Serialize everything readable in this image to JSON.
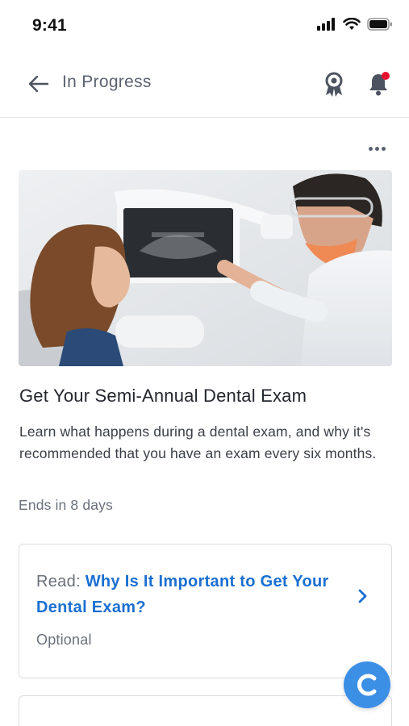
{
  "status_bar": {
    "time": "9:41",
    "icons": [
      "signal-icon",
      "wifi-icon",
      "battery-icon"
    ]
  },
  "header": {
    "back_icon": "arrow-left-icon",
    "title": "In Progress",
    "award_icon": "award-ribbon-icon",
    "bell_icon": "bell-icon",
    "notification_dot_color": "#e5142e"
  },
  "more_menu": {
    "icon": "more-horizontal-icon"
  },
  "hero_image": {
    "subject": "dentist-showing-xray-to-patient"
  },
  "program": {
    "title": "Get Your Semi-Annual Dental Exam",
    "description": "Learn what happens during a dental exam, and why it's recommended that you have an exam every six months.",
    "ends": "Ends in 8 days"
  },
  "tasks": [
    {
      "prefix": "Read: ",
      "link": "Why Is It Important to Get Your Dental Exam?",
      "status": "Optional",
      "icon": "chevron-right-icon"
    }
  ],
  "chat_fab": {
    "icon": "chat-c-icon",
    "color": "#3b8fe5"
  },
  "colors": {
    "link": "#1a6fd1",
    "muted": "#6a707b",
    "divider": "#e3e5e8"
  }
}
